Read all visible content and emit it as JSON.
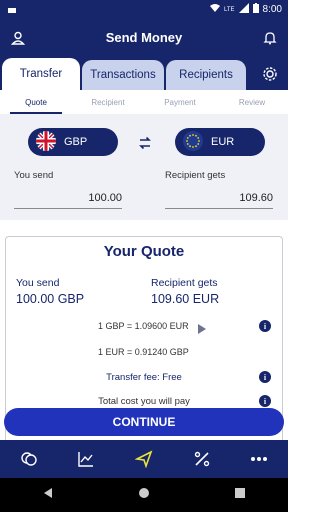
{
  "statusbar": {
    "time": "8:00",
    "network": "LTE"
  },
  "appbar": {
    "title": "Send Money"
  },
  "tabs": [
    {
      "label": "Transfer",
      "active": true
    },
    {
      "label": "Transactions",
      "active": false
    },
    {
      "label": "Recipients",
      "active": false
    }
  ],
  "steps": [
    {
      "label": "Quote",
      "active": true
    },
    {
      "label": "Recipient",
      "active": false
    },
    {
      "label": "Payment",
      "active": false
    },
    {
      "label": "Review",
      "active": false
    }
  ],
  "currency": {
    "from": {
      "code": "GBP",
      "flag": "uk-flag-icon"
    },
    "to": {
      "code": "EUR",
      "flag": "eu-flag-icon"
    },
    "send_label": "You send",
    "send_value": "100.00",
    "receive_label": "Recipient gets",
    "receive_value": "109.60"
  },
  "quote": {
    "title": "Your Quote",
    "send_label": "You send",
    "send_value": "100.00 GBP",
    "receive_label": "Recipient gets",
    "receive_value": "109.60 EUR",
    "rate1": "1 GBP = 1.09600 EUR",
    "rate2": "1 EUR = 0.91240 GBP",
    "fee": "Transfer fee: Free",
    "total": "Total cost you will pay"
  },
  "continue_label": "CONTINUE",
  "colors": {
    "primary": "#17266b",
    "accent": "#2233bb",
    "tab_inactive": "#c9d2ec",
    "nav_active": "#e8e33a"
  },
  "bottom_nav": [
    "coins-icon",
    "chart-icon",
    "send-icon",
    "percent-icon",
    "more-icon"
  ]
}
